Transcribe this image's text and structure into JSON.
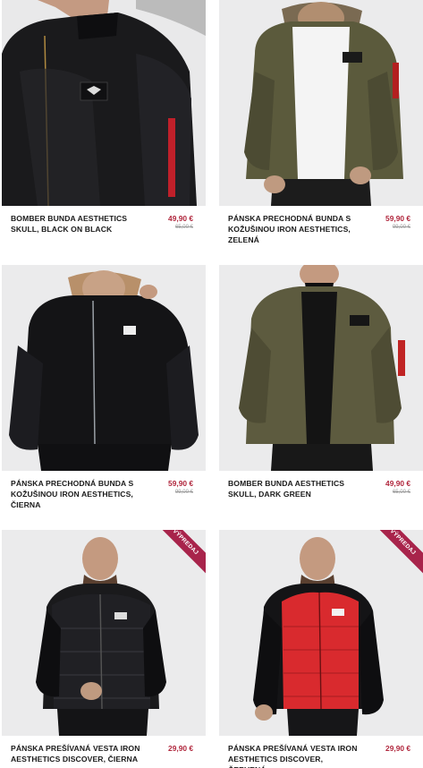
{
  "products": [
    {
      "name": "BOMBER BUNDA AESTHETICS SKULL, BLACK ON BLACK",
      "price": "49,90 €",
      "old_price": "65,00 €",
      "badge": ""
    },
    {
      "name": "PÁNSKA PRECHODNÁ BUNDA S KOŽUŠINOU IRON AESTHETICS, ZELENÁ",
      "price": "59,90 €",
      "old_price": "99,00 €",
      "badge": ""
    },
    {
      "name": "PÁNSKA PRECHODNÁ BUNDA S KOŽUŠINOU IRON AESTHETICS, ČIERNA",
      "price": "59,90 €",
      "old_price": "99,00 €",
      "badge": ""
    },
    {
      "name": "BOMBER BUNDA AESTHETICS SKULL, DARK GREEN",
      "price": "49,90 €",
      "old_price": "65,00 €",
      "badge": ""
    },
    {
      "name": "PÁNSKA PREŠÍVANÁ VESTA IRON AESTHETICS DISCOVER, ČIERNA",
      "price": "29,90 €",
      "old_price": "",
      "badge": "VÝPREDAJ"
    },
    {
      "name": "PÁNSKA PREŠÍVANÁ VESTA IRON AESTHETICS DISCOVER, ČERVENÁ",
      "price": "29,90 €",
      "old_price": "",
      "badge": "VÝPREDAJ"
    }
  ],
  "colors": {
    "price": "#b0263c",
    "badge": "#a8244b",
    "photo_bg": "#ececec"
  }
}
